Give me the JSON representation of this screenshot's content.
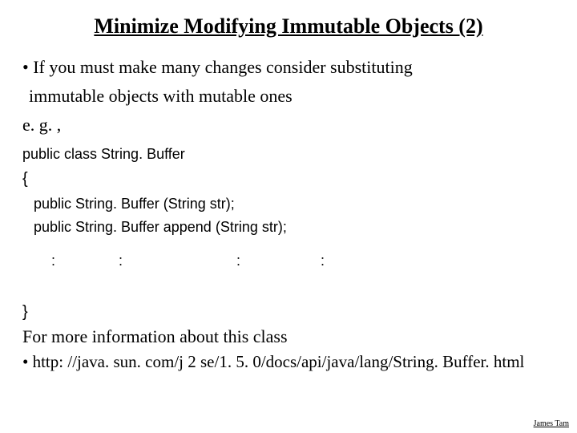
{
  "title": "Minimize Modifying Immutable Objects (2)",
  "bullet": {
    "line1": "• If you must make many changes consider substituting",
    "line2": "immutable objects with mutable ones"
  },
  "eg": "e. g. ,",
  "code": {
    "decl": "public class String. Buffer",
    "open": "{",
    "ctor": "public String. Buffer (String str);",
    "append": "public String. Buffer append (String str);",
    "ellipsis": ":           :                    :              :",
    "close": "}"
  },
  "moreinfo": "For more information about this class",
  "link": "• http: //java. sun. com/j 2 se/1. 5. 0/docs/api/java/lang/String. Buffer. html",
  "author": "James Tam"
}
